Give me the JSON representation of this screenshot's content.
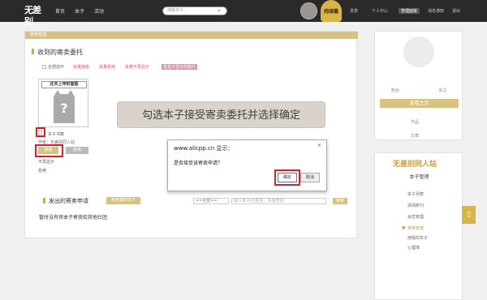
{
  "topnav": {
    "logo": "无差别",
    "links": [
      "首页",
      "本子",
      "活动"
    ],
    "search_placeholder": "搜索本子...",
    "badge": "肉球酱",
    "right": [
      "发表",
      "个人中心",
      "管理面板",
      "消息通知",
      "退出"
    ]
  },
  "main": {
    "bar": "寄卖管理",
    "received_title": "收到的寄卖委托",
    "toolbar": [
      "全部选中",
      "批量接受",
      "批量拒绝",
      "批量不再显示",
      "查看不显示的委托"
    ],
    "card": {
      "cover_text": "还未上传封面图",
      "q": "?",
      "item": "本子书籍",
      "author": "作者：无差别同人站",
      "accept": "接受",
      "reject": "拒绝",
      "hide": "不再显示",
      "status": "拒绝"
    },
    "sent_title": "发出的寄卖申请",
    "sent_btn": "寄卖我的本子",
    "filter": "==全部==",
    "filter_placeholder": "输入本子/社团名，快速查找",
    "search": "搜索",
    "empty": "暂时没有将本子寄卖给其他社团"
  },
  "banner": "勾选本子接受寄卖委托并选择确定",
  "dialog": {
    "title": "www.allcpp.cn 显示：",
    "message": "是否接受该寄卖申请？",
    "ok": "确定",
    "cancel": "取消",
    "close": "×"
  },
  "side": {
    "fans": "粉丝",
    "follow": "关注",
    "btn": "查看主页",
    "works": "作品",
    "articles": "文章"
  },
  "side2": {
    "logo": "无差别同人站",
    "head": "本子管理",
    "menu": [
      "本子列表",
      "添加新刊",
      "会志管理",
      "寄卖管理",
      "搜我的本子",
      "心理准"
    ],
    "active": 3
  },
  "float": "▯"
}
